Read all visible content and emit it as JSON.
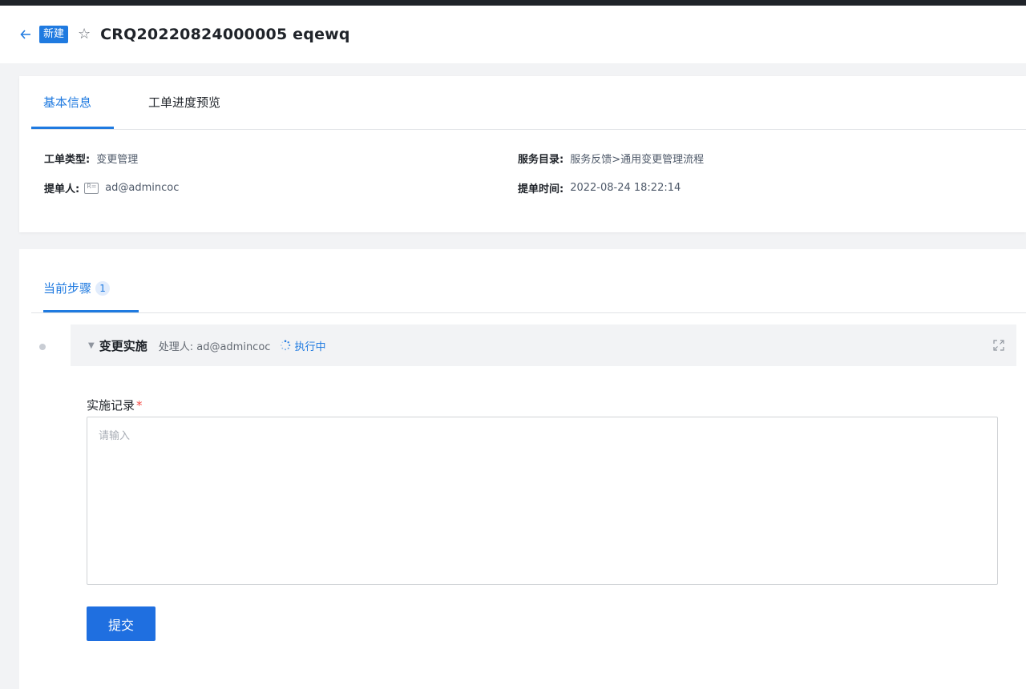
{
  "header": {
    "status_badge": "新建",
    "title": "CRQ20220824000005  eqewq"
  },
  "basic_tabs": [
    {
      "label": "基本信息"
    },
    {
      "label": "工单进度预览"
    }
  ],
  "info": {
    "ticket_type_label": "工单类型:",
    "ticket_type_value": "变更管理",
    "service_catalog_label": "服务目录:",
    "service_catalog_value": "服务反馈>通用变更管理流程",
    "submitter_label": "提单人:",
    "submitter_value": "ad@admincoc",
    "submit_time_label": "提单时间:",
    "submit_time_value": "2022-08-24 18:22:14"
  },
  "steps_tab": {
    "label": "当前步骤",
    "count": "1"
  },
  "step": {
    "name": "变更实施",
    "handler": "处理人: ad@admincoc",
    "status": "执行中"
  },
  "form": {
    "field_label": "实施记录",
    "required_mark": "*",
    "placeholder": "请输入",
    "submit_label": "提交"
  },
  "colors": {
    "accent": "#1f7ae0",
    "required": "#f54a45"
  }
}
